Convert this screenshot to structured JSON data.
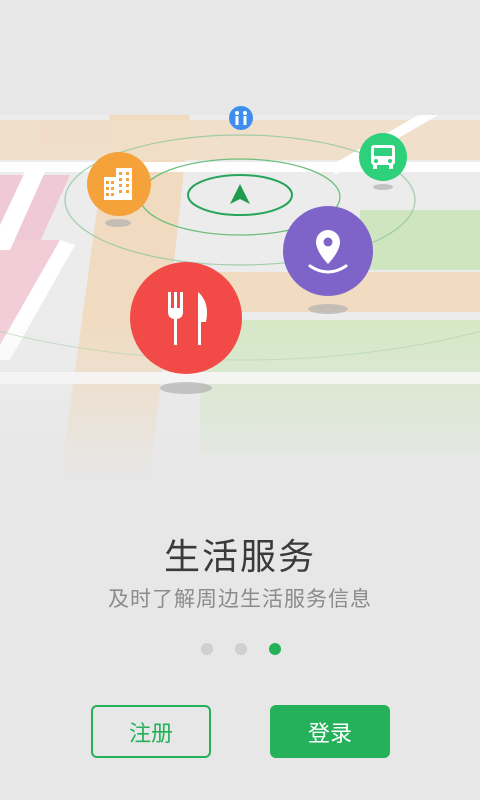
{
  "onboarding": {
    "title": "生活服务",
    "subtitle": "及时了解周边生活服务信息",
    "page_count": 3,
    "active_page": 3
  },
  "buttons": {
    "register_label": "注册",
    "login_label": "登录"
  },
  "icons": [
    "building-icon",
    "restroom-icon",
    "bus-icon",
    "navigation-arrow-icon",
    "location-pin-icon",
    "restaurant-icon"
  ],
  "colors": {
    "accent": "#25b05a",
    "restaurant": "#f24a47",
    "building": "#f5a23a",
    "location": "#7e64c9",
    "bus": "#2ed07c",
    "restroom": "#3d8ef0"
  }
}
